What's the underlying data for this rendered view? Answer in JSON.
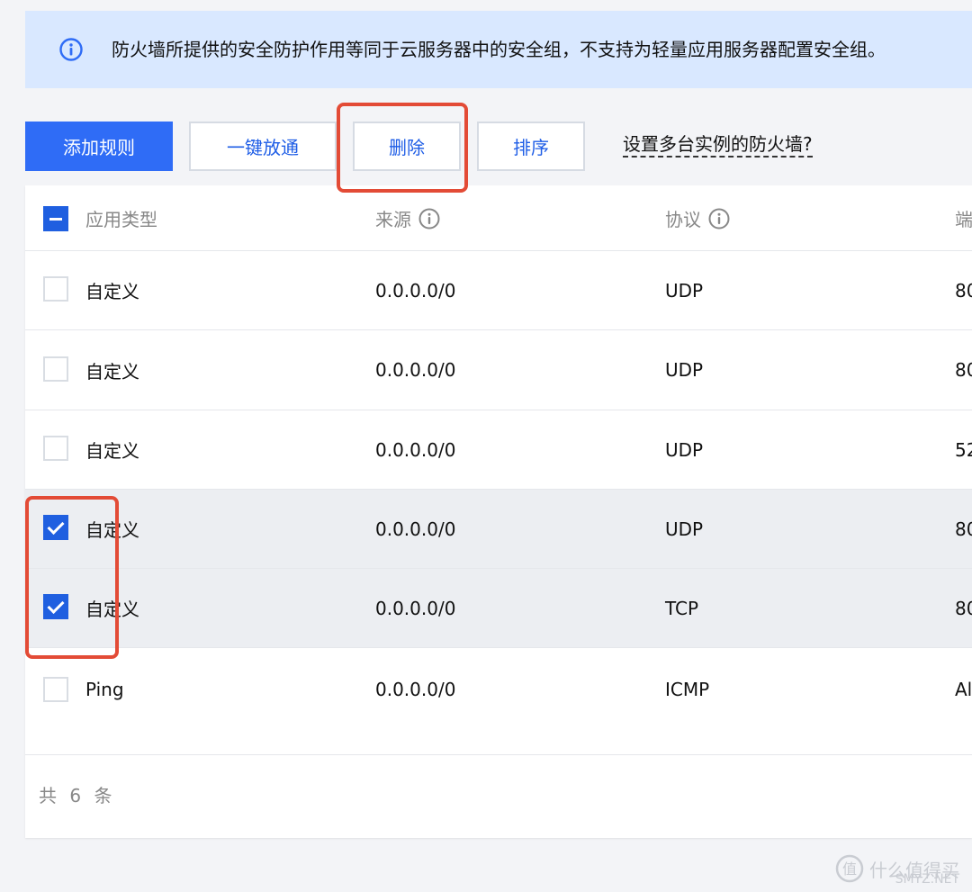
{
  "alert": {
    "icon": "info-icon",
    "text": "防火墙所提供的安全防护作用等同于云服务器中的安全组，不支持为轻量应用服务器配置安全组。"
  },
  "toolbar": {
    "add_rule": "添加规则",
    "quick_open": "一键放通",
    "delete": "删除",
    "sort": "排序",
    "help_link": "设置多台实例的防火墙?"
  },
  "table": {
    "headers": {
      "type": "应用类型",
      "source": "来源",
      "protocol": "协议",
      "port": "端"
    },
    "rows": [
      {
        "type": "自定义",
        "source": "0.0.0.0/0",
        "protocol": "UDP",
        "port": "80",
        "checked": false
      },
      {
        "type": "自定义",
        "source": "0.0.0.0/0",
        "protocol": "UDP",
        "port": "80",
        "checked": false
      },
      {
        "type": "自定义",
        "source": "0.0.0.0/0",
        "protocol": "UDP",
        "port": "52",
        "checked": false
      },
      {
        "type": "自定义",
        "source": "0.0.0.0/0",
        "protocol": "UDP",
        "port": "80",
        "checked": true
      },
      {
        "type": "自定义",
        "source": "0.0.0.0/0",
        "protocol": "TCP",
        "port": "80",
        "checked": true
      },
      {
        "type": "Ping",
        "source": "0.0.0.0/0",
        "protocol": "ICMP",
        "port": "Al",
        "checked": false
      }
    ],
    "total": "共 6 条"
  },
  "watermark": {
    "text": "什么值得买",
    "site": "SMYZ.NET"
  },
  "colors": {
    "primary": "#2f6cf6",
    "alert_bg": "#d9e8ff",
    "highlight": "#e34b36"
  }
}
